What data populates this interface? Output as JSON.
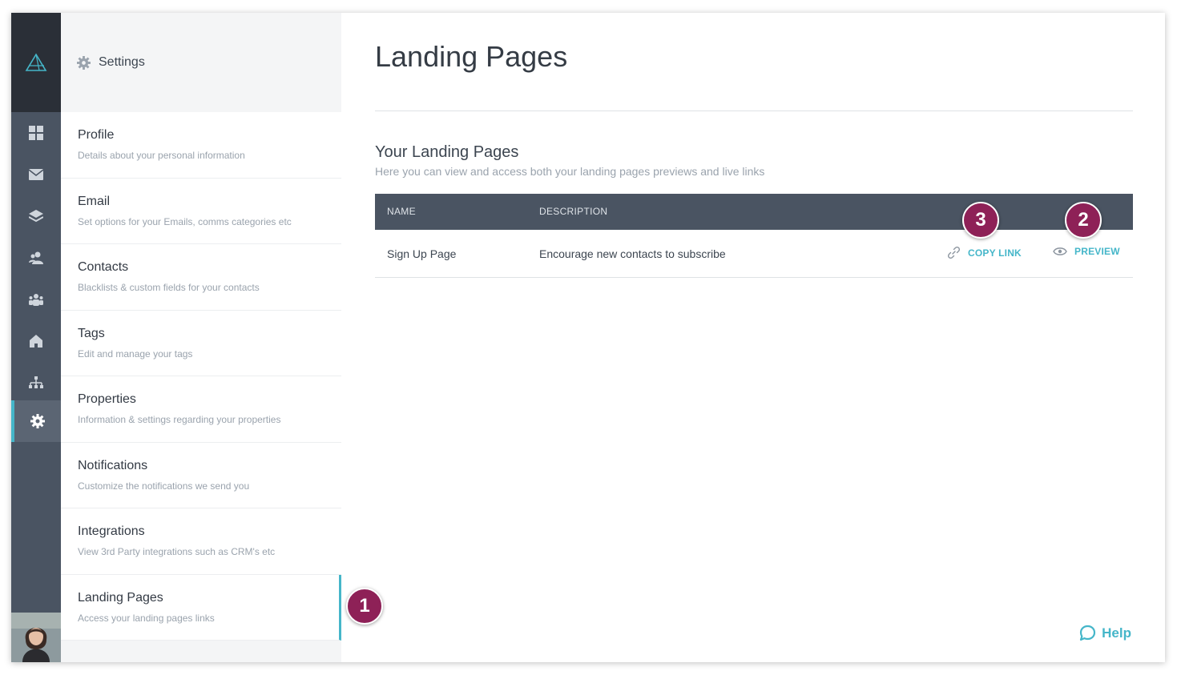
{
  "settings": {
    "title": "Settings"
  },
  "menu": [
    {
      "label": "Profile",
      "desc": "Details about your personal information"
    },
    {
      "label": "Email",
      "desc": "Set options for your Emails, comms categories etc"
    },
    {
      "label": "Contacts",
      "desc": "Blacklists & custom fields for your contacts"
    },
    {
      "label": "Tags",
      "desc": "Edit and manage your tags"
    },
    {
      "label": "Properties",
      "desc": "Information & settings regarding your properties"
    },
    {
      "label": "Notifications",
      "desc": "Customize the notifications we send you"
    },
    {
      "label": "Integrations",
      "desc": "View 3rd Party integrations such as CRM's etc"
    },
    {
      "label": "Landing Pages",
      "desc": "Access your landing pages links"
    }
  ],
  "main": {
    "title": "Landing Pages",
    "section_title": "Your Landing Pages",
    "section_subtitle": "Here you can view and access both your landing pages previews and live links"
  },
  "table": {
    "headers": {
      "name": "NAME",
      "description": "DESCRIPTION"
    },
    "rows": [
      {
        "name": "Sign Up Page",
        "description": "Encourage new contacts to subscribe",
        "copy_link": "COPY LINK",
        "preview": "PREVIEW"
      }
    ]
  },
  "badges": {
    "one": "1",
    "two": "2",
    "three": "3"
  },
  "help": {
    "label": "Help"
  },
  "icons": {
    "rail": [
      "logo-icon",
      "dashboard-icon",
      "mail-icon",
      "layers-icon",
      "contacts-icon",
      "team-icon",
      "home-icon",
      "sitemap-icon",
      "settings-gear-icon"
    ]
  },
  "colors": {
    "accent": "#45b6c9",
    "rail": "#4a5462",
    "badge": "#8e2157"
  }
}
